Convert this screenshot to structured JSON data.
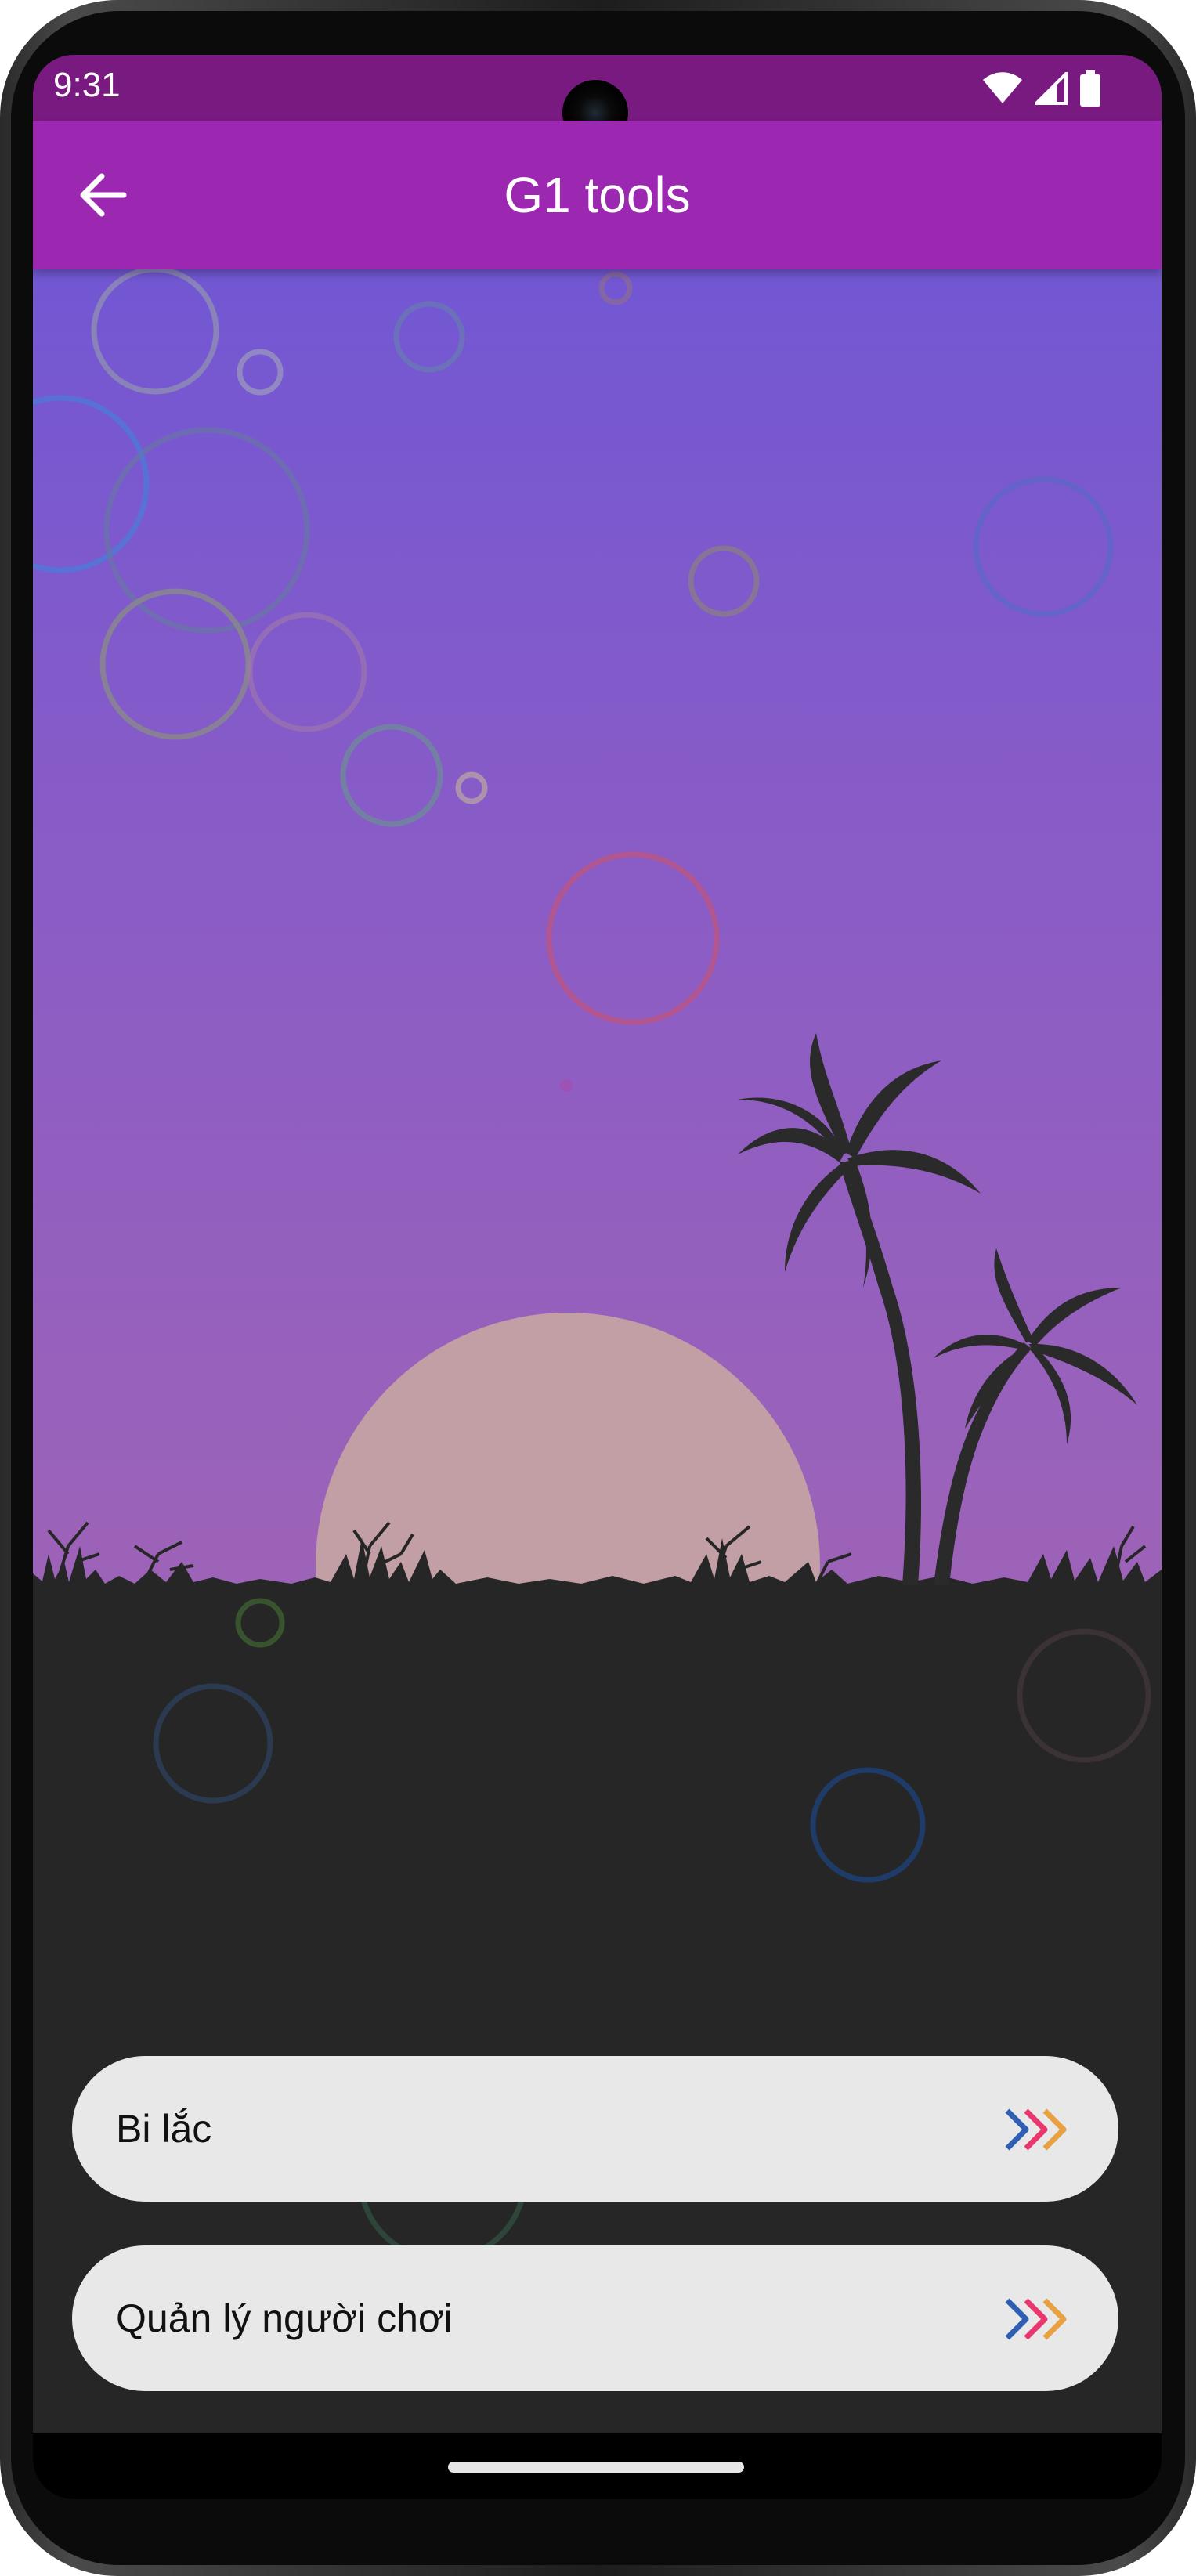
{
  "status_bar": {
    "time": "9:31",
    "icons": [
      "wifi-icon",
      "cellular-signal-icon",
      "battery-icon"
    ]
  },
  "app_bar": {
    "title": "G1 tools",
    "back_icon": "arrow-back-icon"
  },
  "menu": {
    "items": [
      {
        "label": "Bi lắc",
        "icon": "triple-chevron-right-icon"
      },
      {
        "label": "Quản lý người chơi",
        "icon": "triple-chevron-right-icon"
      }
    ]
  },
  "colors": {
    "status_bar": "#791a80",
    "app_bar": "#9c27b0",
    "sky_top": "#7257d3",
    "sky_bottom": "#9d63b7",
    "ground": "#262626",
    "sun": "#c29ea5",
    "card": "#e8e8e8",
    "chevron_1": "#2f5fb5",
    "chevron_2": "#e8376e",
    "chevron_3": "#e8a040"
  }
}
